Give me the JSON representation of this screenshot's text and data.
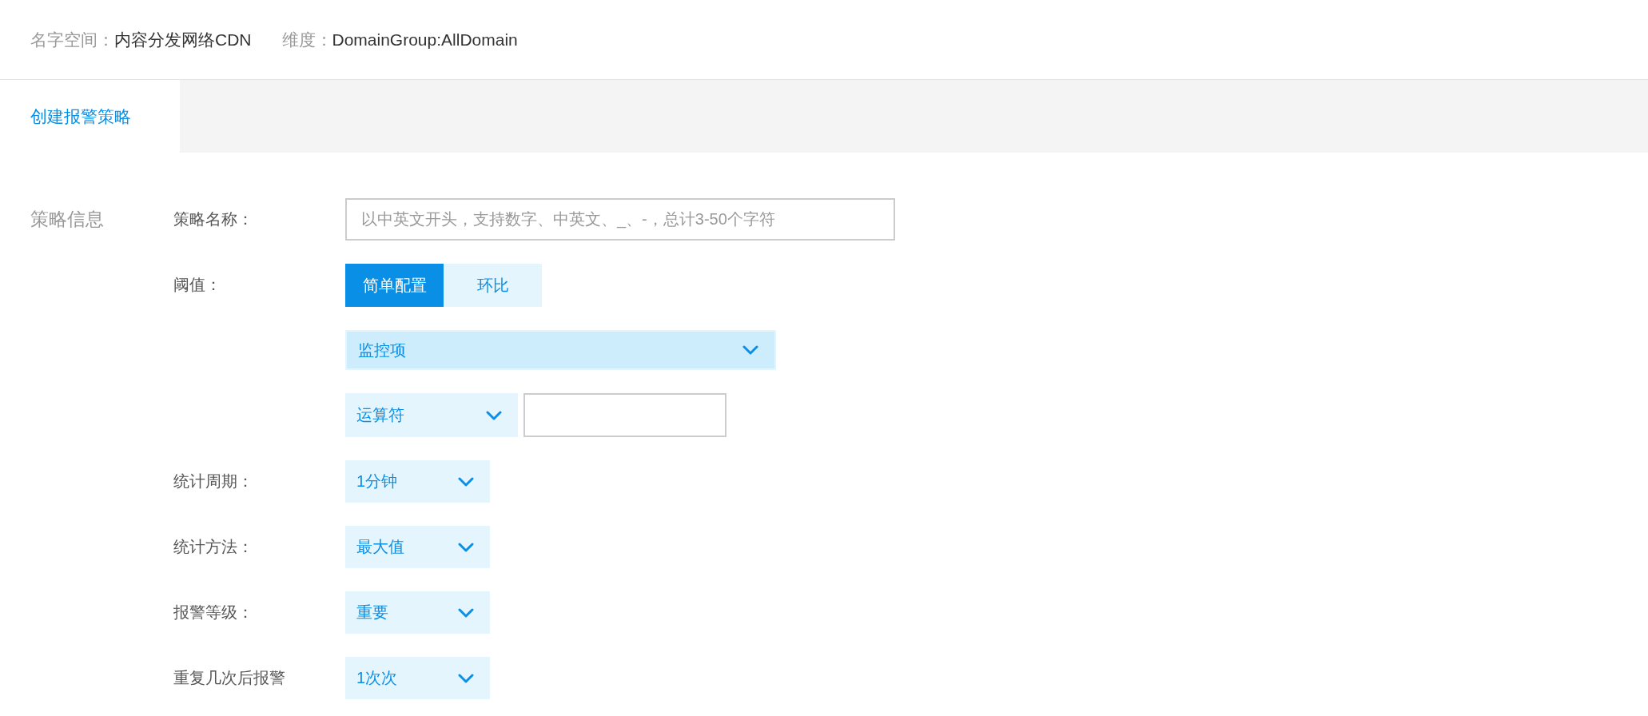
{
  "header": {
    "namespace_label": "名字空间：",
    "namespace_value": "内容分发网络CDN",
    "dimension_label": "维度：",
    "dimension_value": "DomainGroup:AllDomain"
  },
  "tabs": [
    {
      "label": "创建报警策略",
      "selected": true
    }
  ],
  "section": {
    "title": "策略信息",
    "fields": [
      {
        "kind": "text",
        "label": "策略名称：",
        "placeholder": "以中英文开头，支持数字、中英文、_、-，总计3-50个字符"
      },
      {
        "kind": "threshold",
        "label": "阈值：",
        "modes": [
          {
            "label": "简单配置",
            "selected": true
          },
          {
            "label": "环比",
            "selected": false
          }
        ],
        "metric": "监控项",
        "operator": "运算符"
      },
      {
        "kind": "select",
        "label": "统计周期：",
        "value": "1分钟"
      },
      {
        "kind": "select",
        "label": "统计方法：",
        "value": "最大值"
      },
      {
        "kind": "select",
        "label": "报警等级：",
        "value": "重要"
      },
      {
        "kind": "select",
        "label": "重复几次后报警",
        "value": "1次次"
      }
    ]
  }
}
